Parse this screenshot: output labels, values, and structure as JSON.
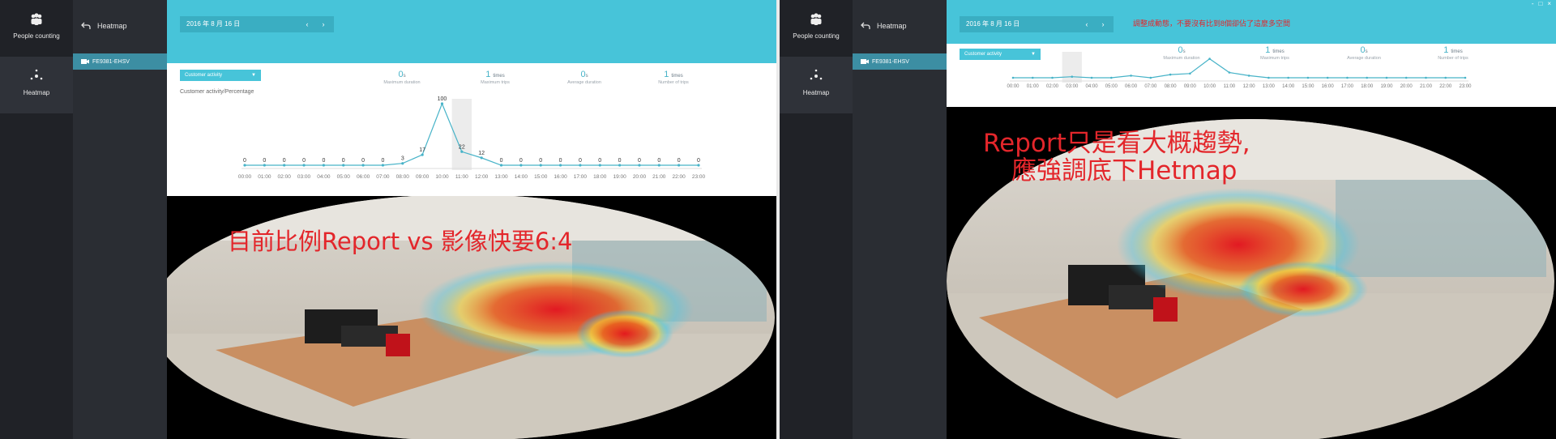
{
  "window": {
    "controls": [
      "-",
      "□",
      "×"
    ]
  },
  "panels": [
    {
      "nav": {
        "items": [
          {
            "label": "People counting"
          },
          {
            "label": "Heatmap"
          }
        ]
      },
      "side": {
        "back_label": "Heatmap",
        "camera": "FE9381-EHSV"
      },
      "header": {
        "date": "2016 年 8 月 16 日",
        "prev": "‹",
        "next": "›"
      },
      "filter": {
        "selected": "Customer activity"
      },
      "stats": [
        {
          "value": "0",
          "unit": "s",
          "label": "Maximum duration"
        },
        {
          "value": "1",
          "unit": "times",
          "label": "Maximum trips"
        },
        {
          "value": "0",
          "unit": "s",
          "label": "Average duration"
        },
        {
          "value": "1",
          "unit": "times",
          "label": "Number of trips"
        }
      ],
      "chart_title": "Customer activity/Percentage",
      "annotation": "目前比例Report vs 影像快要6:4"
    },
    {
      "nav": {
        "items": [
          {
            "label": "People counting"
          },
          {
            "label": "Heatmap"
          }
        ]
      },
      "side": {
        "back_label": "Heatmap",
        "camera": "FE9381-EHSV"
      },
      "header": {
        "date": "2016 年 8 月 16 日",
        "prev": "‹",
        "next": "›"
      },
      "note": "調整成動態，不要沒有比到8個卻佔了這麼多空間",
      "filter": {
        "selected": "Customer activity"
      },
      "stats": [
        {
          "value": "0",
          "unit": "s",
          "label": "Maximum duration"
        },
        {
          "value": "1",
          "unit": "times",
          "label": "Maximum trips"
        },
        {
          "value": "0",
          "unit": "s",
          "label": "Average duration"
        },
        {
          "value": "1",
          "unit": "times",
          "label": "Number of trips"
        }
      ],
      "annotation_line1": "Report只是看大概趨勢,",
      "annotation_line2": "應強調底下Hetmap"
    }
  ],
  "chart_data": [
    {
      "type": "line",
      "title": "Customer activity/Percentage",
      "categories": [
        "00:00",
        "01:00",
        "02:00",
        "03:00",
        "04:00",
        "05:00",
        "06:00",
        "07:00",
        "08:00",
        "09:00",
        "10:00",
        "11:00",
        "12:00",
        "13:00",
        "14:00",
        "15:00",
        "16:00",
        "17:00",
        "18:00",
        "19:00",
        "20:00",
        "21:00",
        "22:00",
        "23:00"
      ],
      "series": [
        {
          "values": [
            0,
            0,
            0,
            0,
            0,
            0,
            0,
            0,
            3,
            17,
            100,
            22,
            12,
            0,
            0,
            0,
            0,
            0,
            0,
            0,
            0,
            0,
            0,
            0
          ]
        }
      ],
      "data_labels": true,
      "highlight_category": "11:00",
      "ylim": [
        0,
        100
      ],
      "color": "#47b3c8"
    },
    {
      "type": "line",
      "categories": [
        "00:00",
        "01:00",
        "02:00",
        "03:00",
        "04:00",
        "05:00",
        "06:00",
        "07:00",
        "08:00",
        "09:00",
        "10:00",
        "11:00",
        "12:00",
        "13:00",
        "14:00",
        "15:00",
        "16:00",
        "17:00",
        "18:00",
        "19:00",
        "20:00",
        "21:00",
        "22:00",
        "23:00"
      ],
      "series": [
        {
          "values": [
            0,
            0,
            0,
            1,
            0,
            0,
            2,
            0,
            3,
            4,
            18,
            5,
            2,
            0,
            0,
            0,
            0,
            0,
            0,
            0,
            0,
            0,
            0,
            0
          ]
        }
      ],
      "data_labels": false,
      "highlight_category": "03:00",
      "ylim": [
        0,
        20
      ],
      "color": "#47b3c8"
    }
  ]
}
